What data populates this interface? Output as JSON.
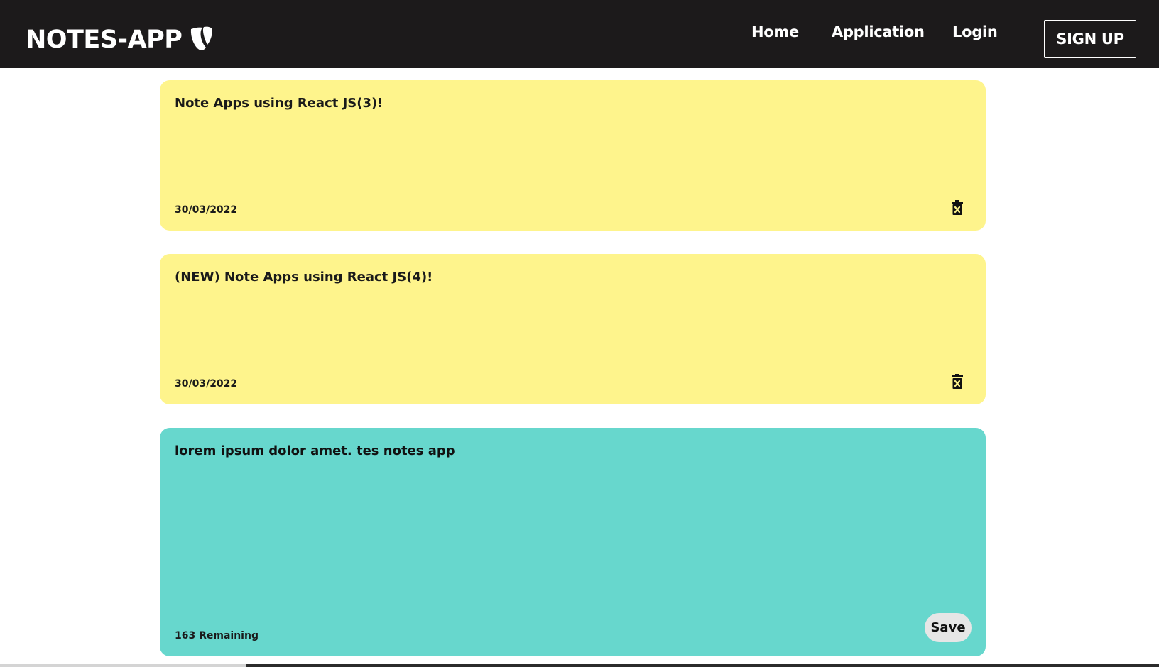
{
  "navbar": {
    "brand": "NOTES-APP",
    "brand_icon": "typo3-icon",
    "links": [
      "Home",
      "Application",
      "Login"
    ],
    "signup_label": "SIGN UP"
  },
  "notes": [
    {
      "text": "Note Apps using React JS(3)!",
      "date": "30/03/2022",
      "color": "#fef48c"
    },
    {
      "text": "(NEW) Note Apps using React JS(4)!",
      "date": "30/03/2022",
      "color": "#fef48c"
    }
  ],
  "new_note": {
    "value": "lorem ipsum dolor amet. tes notes app",
    "remaining": "163 Remaining",
    "save_label": "Save",
    "color": "#67d7cd"
  },
  "icons": {
    "delete": "trash-x-icon"
  }
}
